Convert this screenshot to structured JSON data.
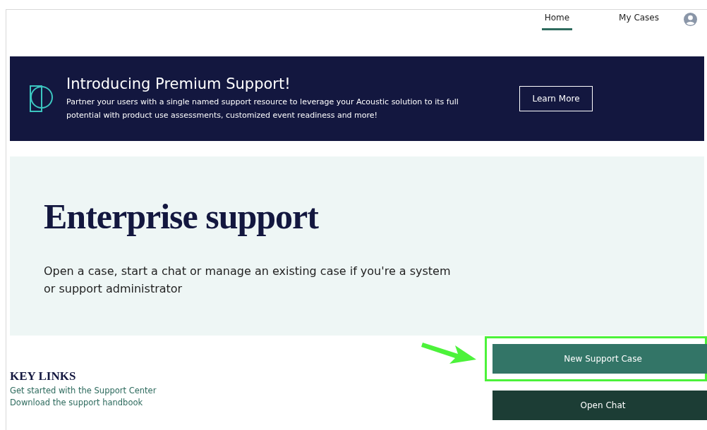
{
  "nav": {
    "tabs": [
      {
        "label": "Home",
        "selected": true
      },
      {
        "label": "My Cases",
        "selected": false
      }
    ]
  },
  "banner": {
    "title": "Introducing Premium Support!",
    "text": "Partner your users with a single named support resource to leverage your Acoustic solution to its full potential with product use assessments, customized event readiness and more!",
    "button": "Learn More"
  },
  "hero": {
    "title": "Enterprise support",
    "text": "Open a case, start a chat or manage an existing case if you're a system or support administrator"
  },
  "key_links": {
    "title": "KEY LINKS",
    "links": [
      "Get started with the Support Center",
      "Download the support handbook"
    ]
  },
  "actions": [
    {
      "label": "New Support Case",
      "highlighted": true,
      "kind": "primary"
    },
    {
      "label": "Open Chat",
      "highlighted": false,
      "kind": "dark"
    }
  ]
}
